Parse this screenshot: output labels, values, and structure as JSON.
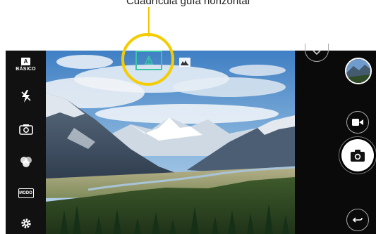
{
  "annotation": {
    "text": "Cuadrícula guía horizontal",
    "ring_color": "#f4cc00"
  },
  "left_bar": {
    "mode": {
      "icon": "a-box-icon",
      "badge": "A",
      "label": "BÁSICO"
    },
    "flash": {
      "icon": "flash-off-icon"
    },
    "switch_camera": {
      "icon": "camera-switch-icon"
    },
    "filter": {
      "icon": "filter-circles-icon"
    },
    "modo": {
      "icon": "mode-box-icon",
      "label": "MODO"
    },
    "settings": {
      "icon": "gear-icon"
    }
  },
  "viewfinder": {
    "level_overlay": {
      "icon": "horizon-level-icon",
      "color": "#37c7a4"
    },
    "wide_indicator": {
      "icon": "wide-angle-icon"
    }
  },
  "right_bar": {
    "chevron": {
      "icon": "chevron-down-icon"
    },
    "gallery": {
      "icon": "gallery-thumbnail"
    },
    "video": {
      "icon": "video-camera-icon"
    },
    "shutter": {
      "icon": "camera-shutter-icon"
    },
    "back": {
      "icon": "back-arrow-icon"
    }
  }
}
